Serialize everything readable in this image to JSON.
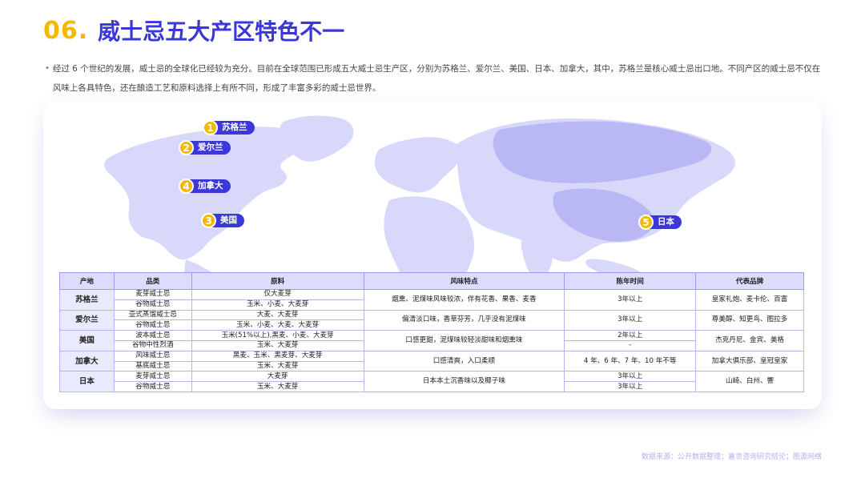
{
  "title": {
    "number": "06.",
    "text": "威士忌五大产区特色不一"
  },
  "intro": {
    "bullet": "•",
    "text": "经过 6 个世纪的发展，威士忌的全球化已经较为充分。目前在全球范围已形成五大威士忌生产区，分别为苏格兰、爱尔兰、美国、日本、加拿大，其中，苏格兰是核心威士忌出口地。不同产区的威士忌不仅在风味上各具特色，还在酿造工艺和原料选择上有所不同，形成了丰富多彩的威士忌世界。"
  },
  "map": {
    "tags": [
      {
        "num": "1",
        "label": "苏格兰"
      },
      {
        "num": "2",
        "label": "爱尔兰"
      },
      {
        "num": "4",
        "label": "加拿大"
      },
      {
        "num": "3",
        "label": "美国"
      },
      {
        "num": "5",
        "label": "日本"
      }
    ],
    "colors": {
      "land": "#d5d5fb",
      "land_dark": "#b9b7f4",
      "accent": "#3b37d9",
      "number": "#f5b800"
    }
  },
  "table": {
    "headers": [
      "产地",
      "品类",
      "原料",
      "风味特点",
      "陈年时间",
      "代表品牌"
    ],
    "groups": [
      {
        "region": "苏格兰",
        "rows": [
          {
            "category": "麦芽威士忌",
            "material": "仅大麦芽"
          },
          {
            "category": "谷物威士忌",
            "material": "玉米、小麦、大麦芽"
          }
        ],
        "flavor": "烟熏、泥煤味风味较浓，伴有花香、果香、麦香",
        "aging": [
          "3年以上"
        ],
        "brands": "皇家礼炮、麦卡伦、百富"
      },
      {
        "region": "爱尔兰",
        "rows": [
          {
            "category": "壶式蒸馏威士忌",
            "material": "大麦、大麦芽"
          },
          {
            "category": "谷物威士忌",
            "material": "玉米、小麦、大麦、大麦芽"
          }
        ],
        "flavor": "偏清淡口味，香草芬芳，几乎没有泥煤味",
        "aging": [
          "3年以上"
        ],
        "brands": "尊美醇、知更鸟、图拉多"
      },
      {
        "region": "美国",
        "rows": [
          {
            "category": "波本威士忌",
            "material": "玉米(51%以上),黑麦、小麦、大麦芽"
          },
          {
            "category": "谷物中性烈酒",
            "material": "玉米、大麦芽"
          }
        ],
        "flavor": "口感更甜，泥煤味较轻淡甜味和烟熏味",
        "aging": [
          "2年以上",
          "-"
        ],
        "brands": "杰克丹尼、金宾、美格"
      },
      {
        "region": "加拿大",
        "rows": [
          {
            "category": "风味威士忌",
            "material": "黑麦、玉米、黑麦芽、大麦芽"
          },
          {
            "category": "基底威士忌",
            "material": "玉米、大麦芽"
          }
        ],
        "flavor": "口感清爽，入口柔顺",
        "aging": [
          "4 年、6 年、7 年、10 年不等"
        ],
        "brands": "加拿大俱乐部、皇冠皇家"
      },
      {
        "region": "日本",
        "rows": [
          {
            "category": "麦芽威士忌",
            "material": "大麦芽"
          },
          {
            "category": "谷物威士忌",
            "material": "玉米、大麦芽"
          }
        ],
        "flavor": "日本本土沉香味以及椰子味",
        "aging": [
          "3年以上",
          "3年以上"
        ],
        "brands": "山崎、白州、響"
      }
    ]
  },
  "source": "数据来源：公开数据整理；嘉世咨询研究结论；图源网络"
}
